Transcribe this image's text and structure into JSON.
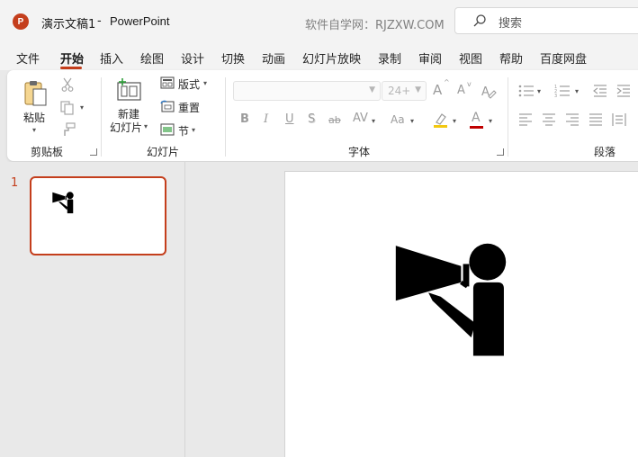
{
  "window": {
    "app_logo": "P",
    "doc_title": "演示文稿1",
    "separator": "-",
    "app_name": "PowerPoint",
    "watermark": "软件自学网：RJZXW.COM",
    "search_placeholder": "搜索"
  },
  "tabs": [
    {
      "label": "文件",
      "active": false
    },
    {
      "label": "开始",
      "active": true
    },
    {
      "label": "插入",
      "active": false
    },
    {
      "label": "绘图",
      "active": false
    },
    {
      "label": "设计",
      "active": false
    },
    {
      "label": "切换",
      "active": false
    },
    {
      "label": "动画",
      "active": false
    },
    {
      "label": "幻灯片放映",
      "active": false
    },
    {
      "label": "录制",
      "active": false
    },
    {
      "label": "审阅",
      "active": false
    },
    {
      "label": "视图",
      "active": false
    },
    {
      "label": "帮助",
      "active": false
    },
    {
      "label": "百度网盘",
      "active": false
    }
  ],
  "ribbon": {
    "clipboard": {
      "paste_label": "粘贴",
      "group_label": "剪贴板"
    },
    "slides": {
      "new_slide_line1": "新建",
      "new_slide_line2": "幻灯片",
      "layout_label": "版式",
      "reset_label": "重置",
      "section_label": "节",
      "group_label": "幻灯片"
    },
    "font": {
      "font_name_value": "",
      "font_size_value": "24+",
      "bold": "B",
      "italic": "I",
      "underline": "U",
      "shadow": "S",
      "strike": "ab",
      "spacing": "AV",
      "change_case": "Aa",
      "increase_size": "A",
      "decrease_size": "A",
      "font_color": "A",
      "group_label": "字体"
    },
    "paragraph": {
      "group_label": "段落"
    }
  },
  "thumbnails": {
    "slide_number": "1"
  },
  "colors": {
    "accent": "#c43e1c",
    "ribbon_bg": "#ffffff",
    "window_bg": "#f3f3f3",
    "workspace_bg": "#e9e9e9",
    "highlight_yellow": "#f2c811",
    "font_color_red": "#c00000"
  }
}
